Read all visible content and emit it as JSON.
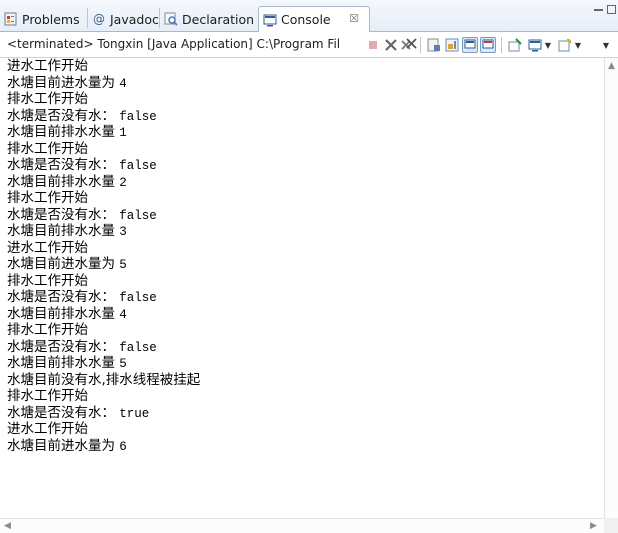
{
  "tabs": [
    {
      "label": "Problems",
      "icon": "problems-icon"
    },
    {
      "label": "Javadoc",
      "icon": "javadoc-icon"
    },
    {
      "label": "Declaration",
      "icon": "declaration-icon"
    },
    {
      "label": "Console",
      "icon": "console-icon",
      "active": true,
      "close": "☒"
    }
  ],
  "status": "<terminated> Tongxin [Java Application] C:\\Program Fil",
  "toolbar_icons": [
    "terminate-icon",
    "remove-launch-icon",
    "remove-all-terminated-icon",
    "clear-console-icon",
    "scroll-lock-icon",
    "show-when-stdout-changes-icon",
    "show-when-stderr-changes-icon",
    "pin-console-icon",
    "display-selected-console-icon",
    "open-console-icon"
  ],
  "console_lines": [
    {
      "text": "进水工作开始",
      "val": ""
    },
    {
      "text": "水塘目前进水量为",
      "val": "4"
    },
    {
      "text": "排水工作开始",
      "val": ""
    },
    {
      "text": "水塘是否没有水：",
      "val": "false"
    },
    {
      "text": "水塘目前排水水量",
      "val": "1"
    },
    {
      "text": "排水工作开始",
      "val": ""
    },
    {
      "text": "水塘是否没有水：",
      "val": "false"
    },
    {
      "text": "水塘目前排水水量",
      "val": "2"
    },
    {
      "text": "排水工作开始",
      "val": ""
    },
    {
      "text": "水塘是否没有水：",
      "val": "false"
    },
    {
      "text": "水塘目前排水水量",
      "val": "3"
    },
    {
      "text": "进水工作开始",
      "val": ""
    },
    {
      "text": "水塘目前进水量为",
      "val": "5"
    },
    {
      "text": "排水工作开始",
      "val": ""
    },
    {
      "text": "水塘是否没有水：",
      "val": "false"
    },
    {
      "text": "水塘目前排水水量",
      "val": "4"
    },
    {
      "text": "排水工作开始",
      "val": ""
    },
    {
      "text": "水塘是否没有水：",
      "val": "false"
    },
    {
      "text": "水塘目前排水水量",
      "val": "5"
    },
    {
      "text": "水塘目前没有水,排水线程被挂起",
      "val": ""
    },
    {
      "text": "排水工作开始",
      "val": ""
    },
    {
      "text": "水塘是否没有水：",
      "val": "true"
    },
    {
      "text": "进水工作开始",
      "val": ""
    },
    {
      "text": "水塘目前进水量为",
      "val": "6"
    }
  ],
  "colors": {
    "tabbar_bg": "#e6eef7",
    "border": "#a9b9cc",
    "text": "#000000",
    "terminate_disabled": "#e8a9a9"
  }
}
